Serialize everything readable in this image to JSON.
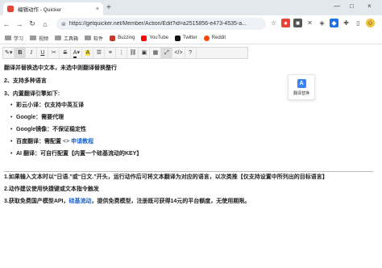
{
  "browser": {
    "tab_title": "编辑动作 - Quicker",
    "tab_close": "×",
    "new_tab": "+",
    "win_min": "—",
    "win_max": "□",
    "win_close": "×",
    "url": "https://getquicker.net/Member/Action/Edit?id=a2515856-e473-4535-a...",
    "nav": {
      "back": "←",
      "forward": "→",
      "reload": "↻",
      "home": "⌂",
      "lock": "⊜"
    },
    "bookmarks": [
      "学习",
      "视频",
      "工具箱",
      "软件",
      "Buzzing",
      "YouTube",
      "Twitter",
      "Reddit"
    ]
  },
  "toolbar": {
    "paint": "✎▾",
    "bold": "B",
    "italic": "I",
    "underline": "U",
    "clear": "✂",
    "strike": "S",
    "fontcolor": "A",
    "highlight": "A",
    "ul": "☰",
    "ol": "≡",
    "align": "⋮",
    "link": "⛓",
    "image": "▣",
    "table": "▦",
    "expand": "⤢",
    "code": "</>",
    "help": "?"
  },
  "content": {
    "line1": "翻译并替换选中文本，未选中则翻译替换整行",
    "line2": "2、支持多种语言",
    "line3": "3、内置翻译引擎如下:",
    "bullets": [
      {
        "text": "彩云小译：仅支持中英互译"
      },
      {
        "text": "Google：需要代理"
      },
      {
        "text": "Google镜像：不保证稳定性"
      },
      {
        "text": "百度翻译：需配置 ",
        "arrow": "<>",
        "link": "申请教程"
      },
      {
        "text": "AI 翻译：可自行配置【内置一个硅基流动的KEY】"
      }
    ],
    "bullet_mark": "•",
    "note1": "1.如果输入文本时以“日语.”或“日文.”开头，运行动作后可将文本翻译为对应的语言，以次类推【仅支持设置中所列出的目标语言】",
    "note2": "2.动作建议使用快捷键或文本指令触发",
    "note3_pre": "3.获取免费国产模型API，",
    "note3_link": "硅基流动",
    "note3_post": "，提供免费模型，注册既可获得14元的平台额度，无使用期限。"
  },
  "popup": {
    "icon_text": "A",
    "label": "翻译替换"
  }
}
